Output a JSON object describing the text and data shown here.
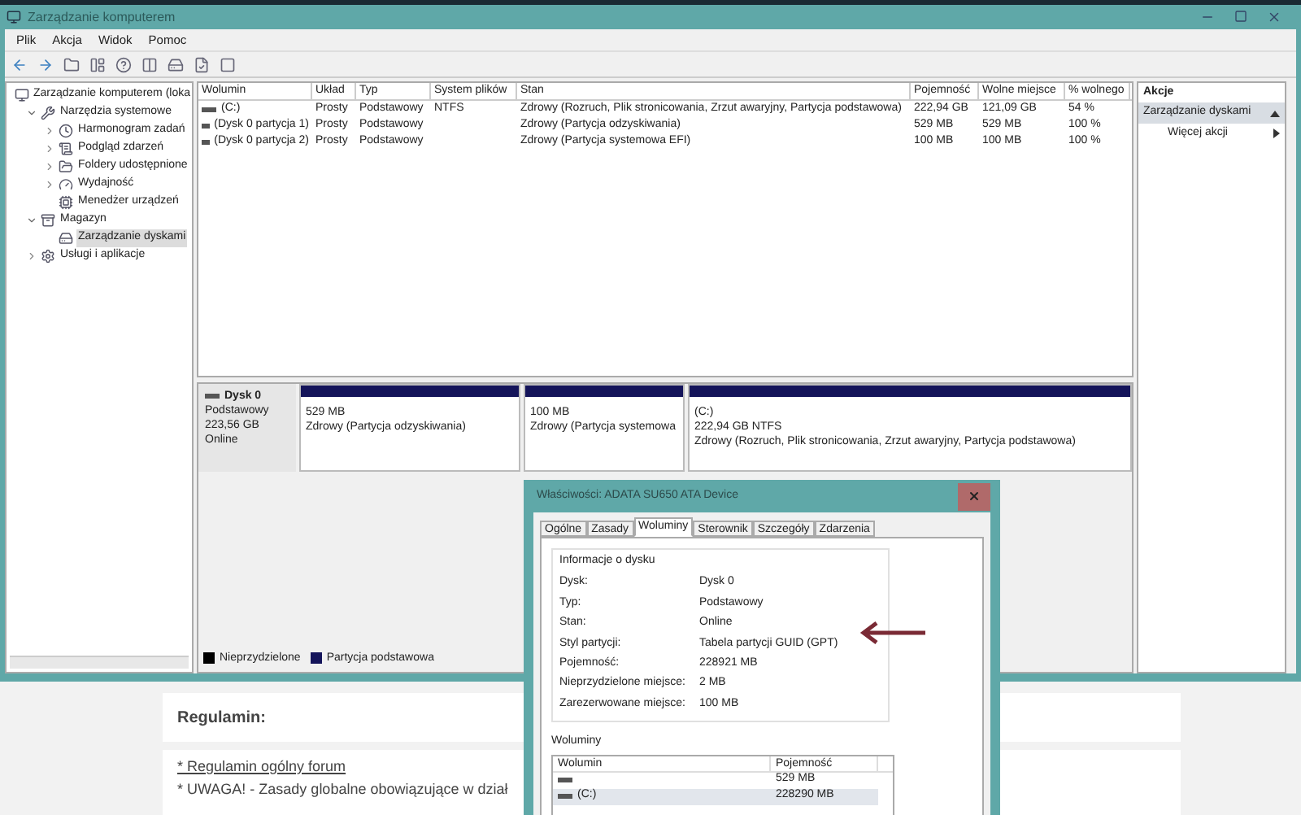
{
  "window": {
    "title": "Zarządzanie komputerem"
  },
  "menu": [
    "Plik",
    "Akcja",
    "Widok",
    "Pomoc"
  ],
  "tree": [
    {
      "label": "Zarządzanie komputerem (loka",
      "selected": false,
      "children": [
        {
          "label": "Narzędzia systemowe",
          "selected": false,
          "expanded": true,
          "children": [
            {
              "label": "Harmonogram zadań",
              "selected": false,
              "expanded": false
            },
            {
              "label": "Podgląd zdarzeń",
              "selected": false,
              "expanded": false
            },
            {
              "label": "Foldery udostępnione",
              "selected": false,
              "expanded": false
            },
            {
              "label": "Wydajność",
              "selected": false,
              "expanded": false
            },
            {
              "label": "Menedżer urządzeń",
              "selected": false
            }
          ]
        },
        {
          "label": "Magazyn",
          "selected": false,
          "expanded": true,
          "children": [
            {
              "label": "Zarządzanie dyskami",
              "selected": true
            }
          ]
        },
        {
          "label": "Usługi i aplikacje",
          "selected": false,
          "expanded": false
        }
      ]
    }
  ],
  "volume_table": {
    "columns": [
      "Wolumin",
      "Układ",
      "Typ",
      "System plików",
      "Stan",
      "Pojemność",
      "Wolne miejsce",
      "% wolnego"
    ],
    "rows": [
      [
        "(C:)",
        "Prosty",
        "Podstawowy",
        "NTFS",
        "Zdrowy (Rozruch, Plik stronicowania, Zrzut awaryjny, Partycja podstawowa)",
        "222,94 GB",
        "121,09 GB",
        "54 %"
      ],
      [
        "(Dysk 0 partycja 1)",
        "Prosty",
        "Podstawowy",
        "",
        "Zdrowy (Partycja odzyskiwania)",
        "529 MB",
        "529 MB",
        "100 %"
      ],
      [
        "(Dysk 0 partycja 2)",
        "Prosty",
        "Podstawowy",
        "",
        "Zdrowy (Partycja systemowa EFI)",
        "100 MB",
        "100 MB",
        "100 %"
      ]
    ]
  },
  "disk": {
    "name": "Dysk 0",
    "type": "Podstawowy",
    "size": "223,56 GB",
    "status": "Online",
    "partitions": [
      {
        "lines": [
          "529 MB",
          "Zdrowy (Partycja odzyskiwania)"
        ]
      },
      {
        "lines": [
          "100 MB",
          "Zdrowy (Partycja systemowa"
        ]
      },
      {
        "lines": [
          "(C:)",
          "222,94 GB NTFS",
          "Zdrowy (Rozruch, Plik stronicowania, Zrzut awaryjny, Partycja podstawowa)"
        ]
      }
    ]
  },
  "legend": [
    {
      "label": "Nieprzydzielone",
      "color": "#000000"
    },
    {
      "label": "Partycja podstawowa",
      "color": "#14145a"
    }
  ],
  "actions": {
    "title": "Akcje",
    "section": "Zarządzanie dyskami",
    "items": [
      "Więcej akcji"
    ]
  },
  "dialog": {
    "title": "Właściwości: ADATA SU650 ATA Device",
    "tabs": [
      {
        "label": "Ogólne",
        "selected": false
      },
      {
        "label": "Zasady",
        "selected": false
      },
      {
        "label": "Woluminy",
        "selected": true
      },
      {
        "label": "Sterownik",
        "selected": false
      },
      {
        "label": "Szczegóły",
        "selected": false
      },
      {
        "label": "Zdarzenia",
        "selected": false
      }
    ],
    "group_title": "Informacje o dysku",
    "fields": [
      {
        "label": "Dysk:",
        "value": "Dysk 0"
      },
      {
        "label": "Typ:",
        "value": "Podstawowy"
      },
      {
        "label": "Stan:",
        "value": "Online"
      },
      {
        "label": "Styl partycji:",
        "value": "Tabela partycji GUID (GPT)"
      },
      {
        "label": "Pojemność:",
        "value": "228921 MB"
      },
      {
        "label": "Nieprzydzielone miejsce:",
        "value": "2 MB"
      },
      {
        "label": "Zarezerwowane miejsce:",
        "value": "100 MB"
      }
    ],
    "volumes_title": "Woluminy",
    "volume_columns": [
      "Wolumin",
      "Pojemność"
    ],
    "volumes": [
      {
        "capacity": "529 MB",
        "selected": false
      },
      {
        "name": "(C:)",
        "capacity": "228290 MB",
        "selected": true
      }
    ]
  },
  "page": {
    "heading": "Regulamin:",
    "link": "* Regulamin ogólny forum",
    "text": "* UWAGA! - Zasady globalne obowiązujące w dział"
  }
}
